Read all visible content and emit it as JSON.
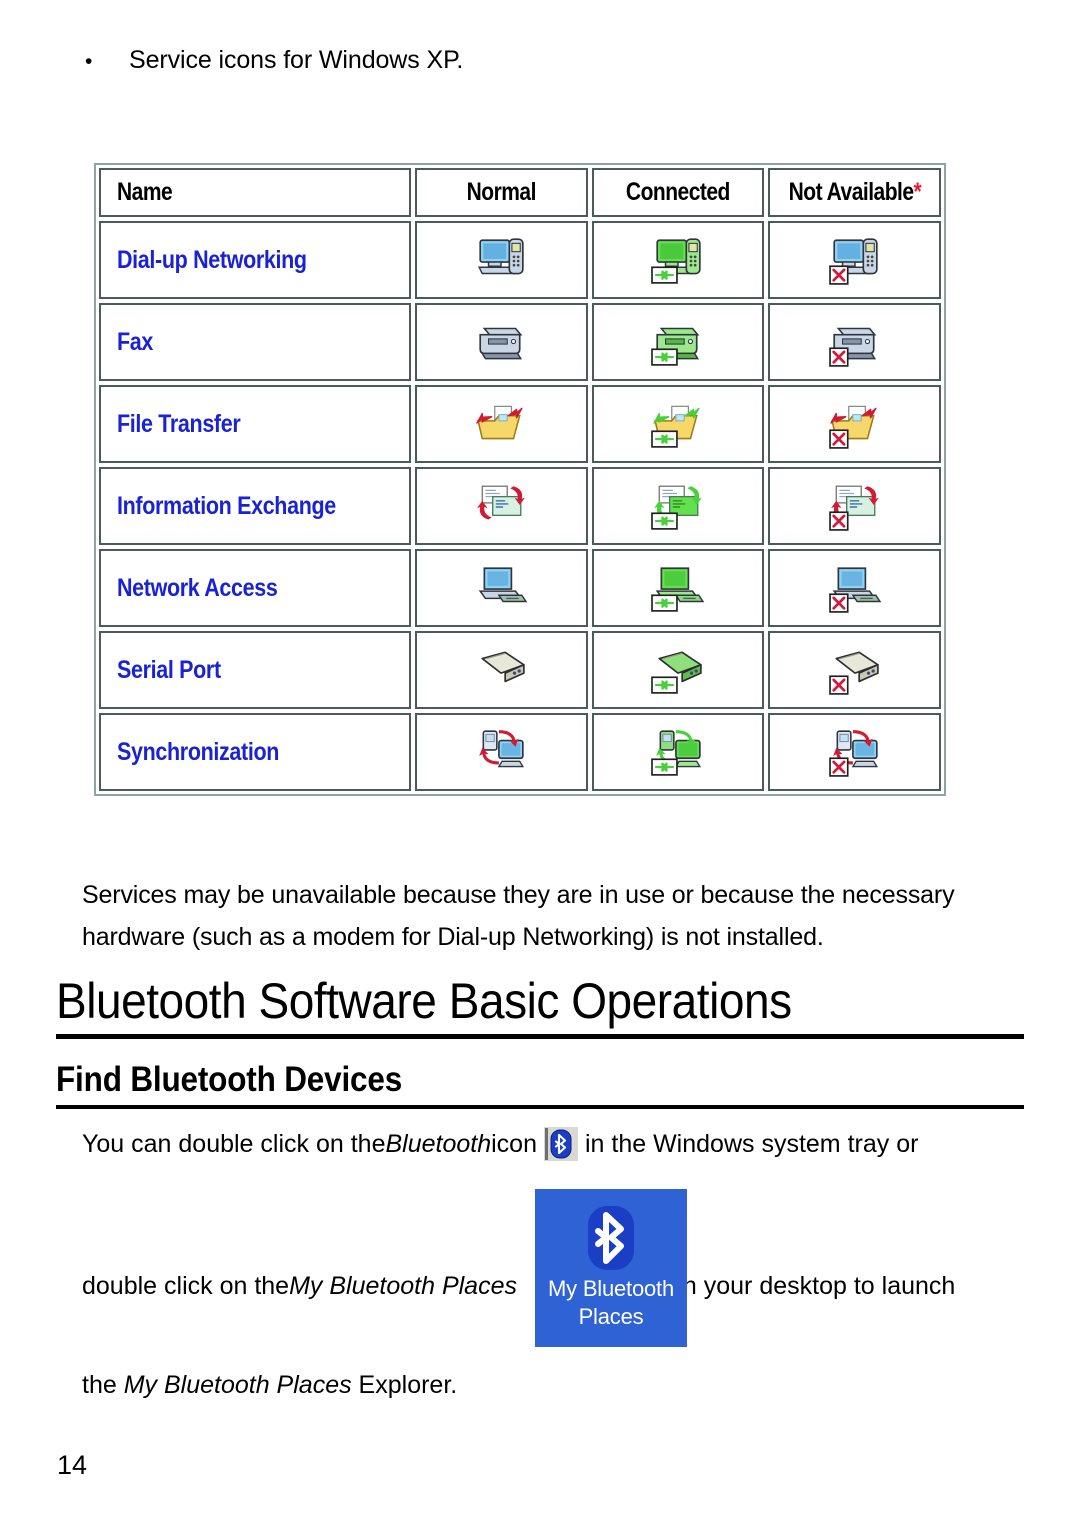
{
  "intro": {
    "bullet": "•",
    "text": "Service icons for Windows XP."
  },
  "table": {
    "headers": {
      "name": "Name",
      "normal": "Normal",
      "connected": "Connected",
      "not_available": "Not Available",
      "not_available_mark": "*"
    },
    "rows": [
      {
        "name": "Dial-up Networking",
        "icon": "computer-phone-icon"
      },
      {
        "name": "Fax",
        "icon": "fax-machine-icon"
      },
      {
        "name": "File Transfer",
        "icon": "folder-transfer-icon"
      },
      {
        "name": "Information Exchange",
        "icon": "business-cards-icon"
      },
      {
        "name": "Network Access",
        "icon": "laptop-network-icon"
      },
      {
        "name": "Serial Port",
        "icon": "serial-connector-icon"
      },
      {
        "name": "Synchronization",
        "icon": "sync-devices-icon"
      }
    ],
    "states": [
      "normal",
      "connected",
      "not-available"
    ],
    "colors": {
      "row_label": "#1922d4",
      "asterisk": "#e21b37",
      "cell_border": "#4c5a5a",
      "table_border": "#8fa3a3",
      "connected_green": "#49d13b",
      "unavailable_red": "#d21a3c"
    }
  },
  "note": "Services may be unavailable because they are in use or because the necessary hardware (such as a modem for Dial-up Networking) is not installed.",
  "headings": {
    "h1": "Bluetooth Software Basic Operations",
    "h2": "Find Bluetooth Devices"
  },
  "body": {
    "tray_line": {
      "part1": "You can double click on the ",
      "italic1": "Bluetooth",
      "part2": " icon ",
      "icon": "bluetooth-tray-icon",
      "part3": " in the Windows system tray or"
    },
    "places_line": {
      "part1": "double click on the ",
      "italic1": "My Bluetooth Places",
      "icon": "my-bluetooth-places-desktop-icon",
      "part2": " on your desktop to launch"
    },
    "explorer_line": {
      "part1": "the ",
      "italic1": "My Bluetooth Places",
      "part2": " Explorer."
    }
  },
  "desktop_icon": {
    "label_line1": "My Bluetooth",
    "label_line2": "Places",
    "background": "#2f62d4",
    "bluetooth_blue": "#1b3fc4"
  },
  "page_number": "14"
}
